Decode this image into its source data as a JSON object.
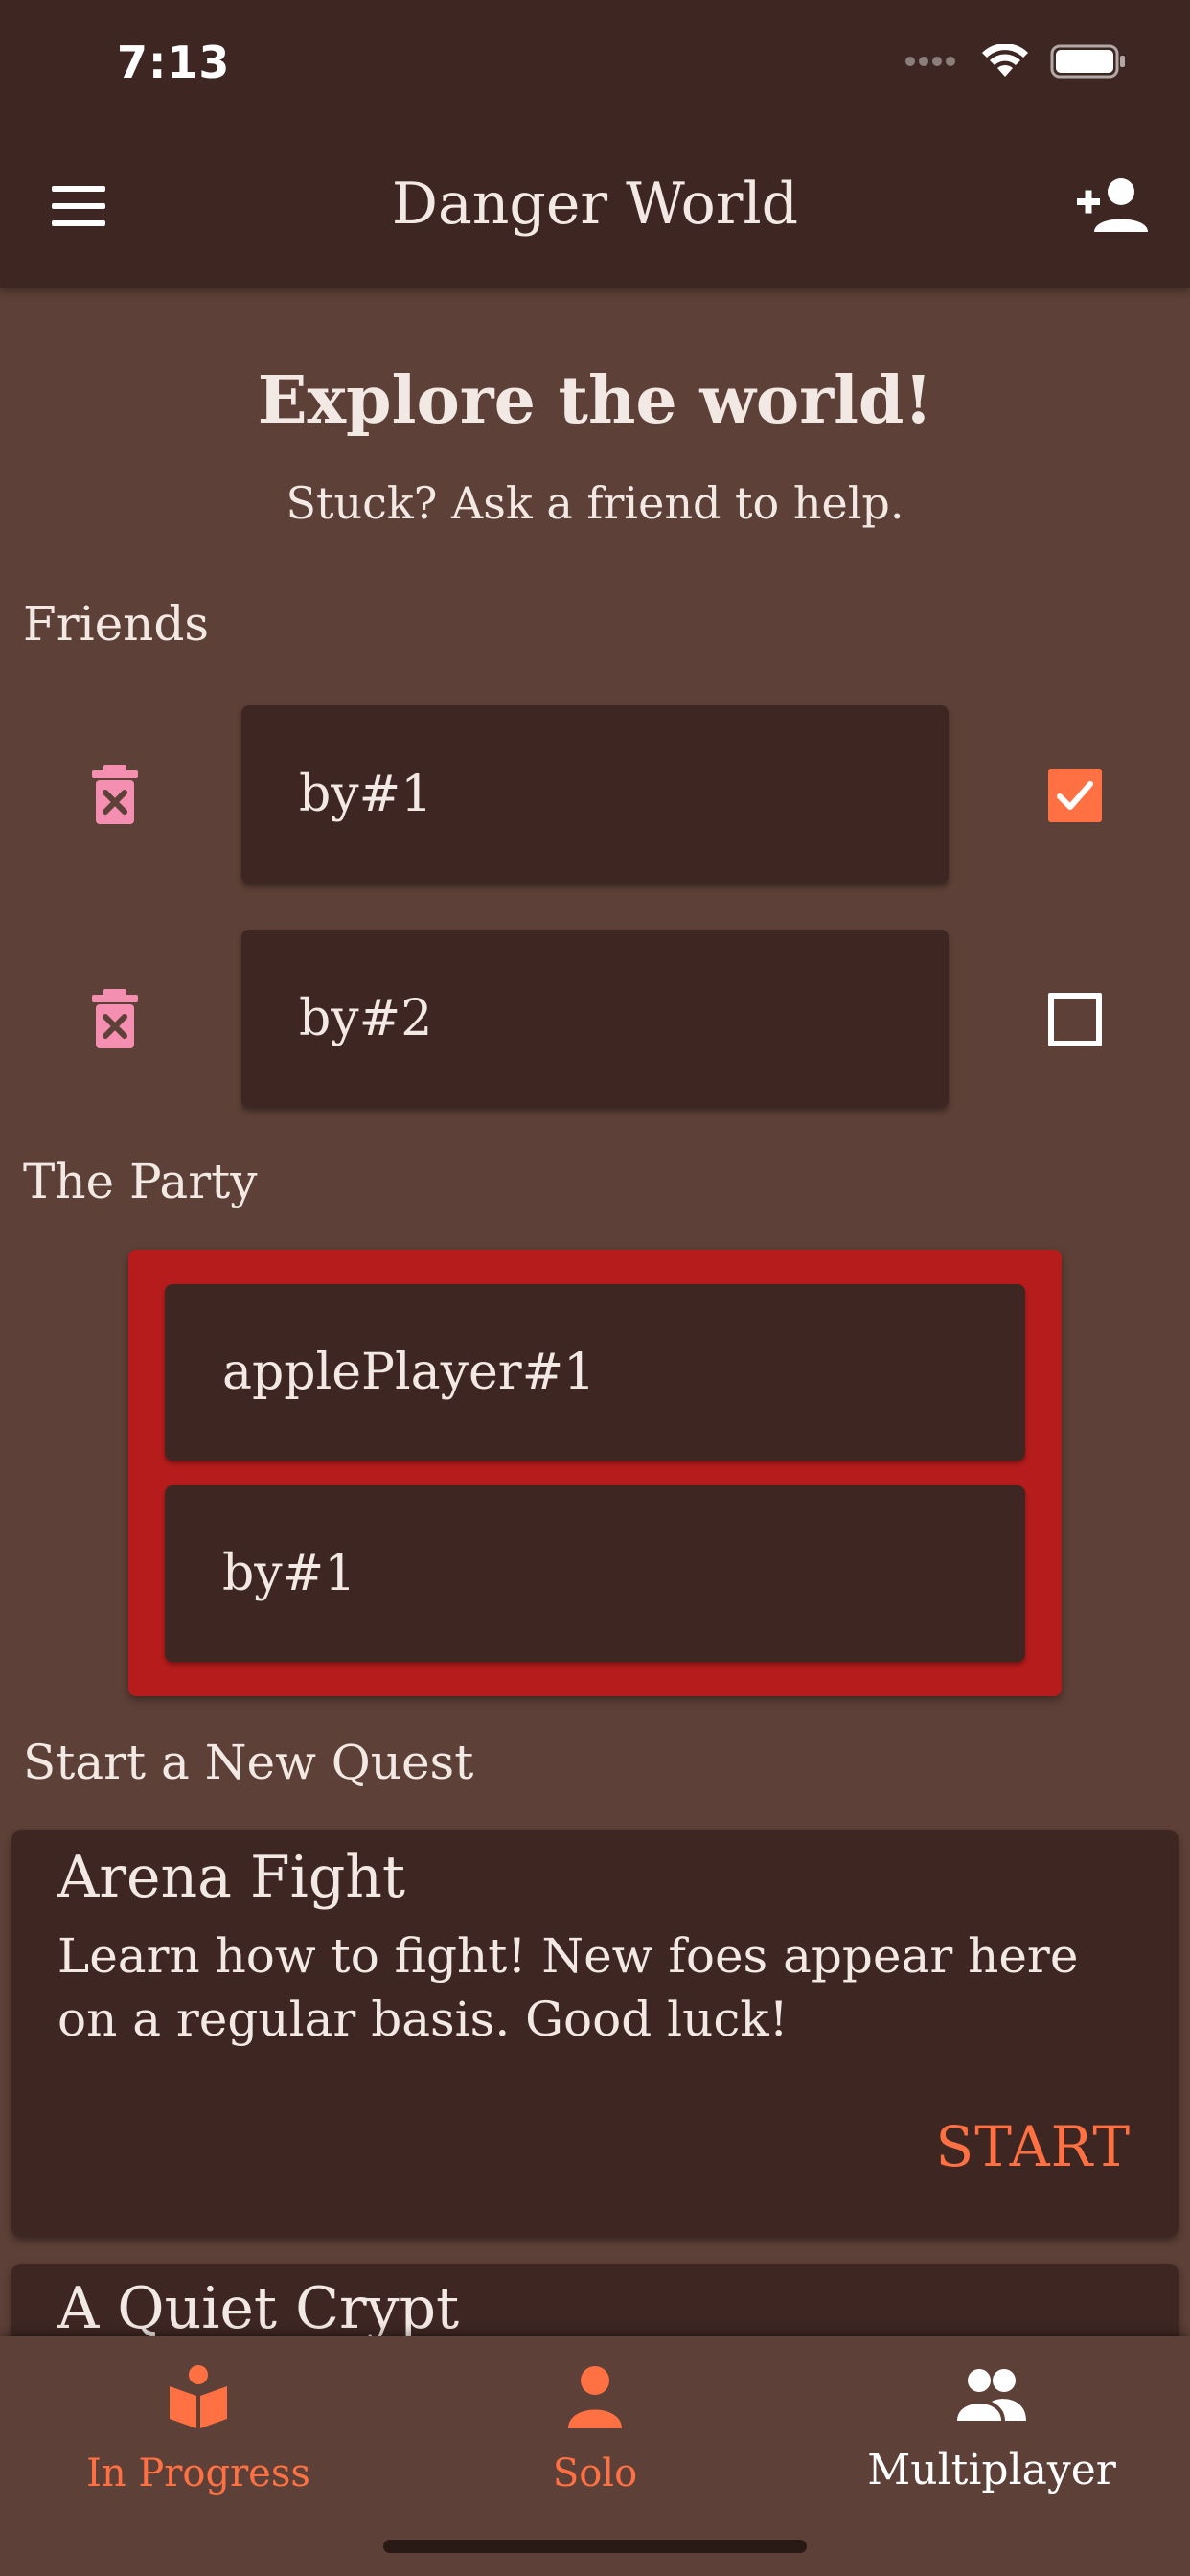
{
  "status_bar": {
    "time": "7:13"
  },
  "app_bar": {
    "title": "Danger World"
  },
  "hero": {
    "title": "Explore the world!",
    "subtitle": "Stuck? Ask a friend to help."
  },
  "friends": {
    "label": "Friends",
    "items": [
      {
        "name": "by#1",
        "checked": true
      },
      {
        "name": "by#2",
        "checked": false
      }
    ]
  },
  "party": {
    "label": "The Party",
    "members": [
      "applePlayer#1",
      "by#1"
    ]
  },
  "quests": {
    "label": "Start a New Quest",
    "items": [
      {
        "name": "Arena Fight",
        "description": "Learn how to fight! New foes appear here on a regular basis. Good luck!",
        "action": "START"
      },
      {
        "name": "A Quiet Crypt"
      }
    ]
  },
  "bottom_nav": {
    "items": [
      {
        "label": "In Progress",
        "icon": "book-open-icon",
        "active": false
      },
      {
        "label": "Solo",
        "icon": "person-icon",
        "active": false
      },
      {
        "label": "Multiplayer",
        "icon": "group-icon",
        "active": true
      }
    ]
  },
  "colors": {
    "background": "#5d4037",
    "surface": "#3e2723",
    "accent": "#ff7043",
    "party_border": "#b71c1c",
    "trash": "#f48fb1"
  }
}
